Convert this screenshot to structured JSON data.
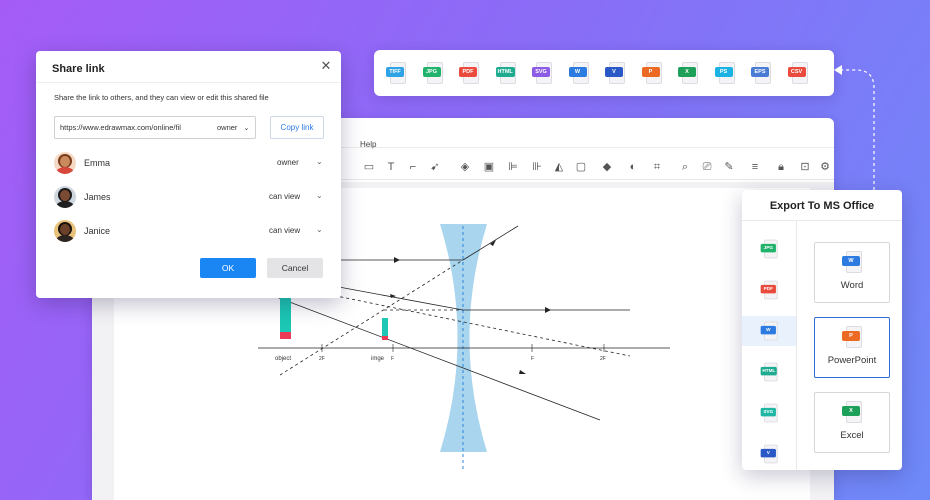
{
  "editor": {
    "menu_help": "Help",
    "diagram_labels": {
      "object": "object",
      "image": "imge",
      "f_left_small": "F",
      "two_f_left": "2F",
      "f_right": "F",
      "two_f_right": "2F"
    }
  },
  "export_strip": {
    "formats": [
      {
        "label": "TIFF",
        "color": "#2fa3e6"
      },
      {
        "label": "JPG",
        "color": "#21b36d"
      },
      {
        "label": "PDF",
        "color": "#ea4b3c"
      },
      {
        "label": "HTML",
        "color": "#1eab8f"
      },
      {
        "label": "SVG",
        "color": "#8c5ce6"
      },
      {
        "label": "W",
        "color": "#2d7be0"
      },
      {
        "label": "V",
        "color": "#2a59c7"
      },
      {
        "label": "P",
        "color": "#ec6a23"
      },
      {
        "label": "X",
        "color": "#1da15a"
      },
      {
        "label": "PS",
        "color": "#1ab3e3"
      },
      {
        "label": "EPS",
        "color": "#4a7cd6"
      },
      {
        "label": "CSV",
        "color": "#ea4b3c"
      }
    ]
  },
  "share": {
    "title": "Share link",
    "description": "Share the link to others, and they can view or edit this shared file",
    "link_url": "https://www.edrawmax.com/online/fil",
    "link_permission": "owner",
    "copy_label": "Copy link",
    "people": [
      {
        "name": "Emma",
        "permission": "owner",
        "skin": "#c98a5e",
        "hair": "#7a3b1a",
        "shirt": "#d8473c",
        "bg": "#f6d9c5"
      },
      {
        "name": "James",
        "permission": "can view",
        "skin": "#7a4a32",
        "hair": "#1a1a1a",
        "shirt": "#1f1f1f",
        "bg": "#cfd6dd"
      },
      {
        "name": "Janice",
        "permission": "can view",
        "skin": "#6b4028",
        "hair": "#1c120c",
        "shirt": "#2b2320",
        "bg": "#e8c17a"
      }
    ],
    "ok_label": "OK",
    "cancel_label": "Cancel"
  },
  "ms_office": {
    "title": "Export To MS Office",
    "left_formats": [
      {
        "label": "JPG",
        "color": "#21b36d"
      },
      {
        "label": "PDF",
        "color": "#ea4b3c"
      },
      {
        "label": "W",
        "color": "#2d7be0"
      },
      {
        "label": "HTML",
        "color": "#1eab8f"
      },
      {
        "label": "SVG",
        "color": "#1fb7a4"
      },
      {
        "label": "V",
        "color": "#2a59c7"
      }
    ],
    "selected_left_index": 2,
    "cards": [
      {
        "label": "Word",
        "tag": "W",
        "color": "#2d7be0"
      },
      {
        "label": "PowerPoint",
        "tag": "P",
        "color": "#ec6a23"
      },
      {
        "label": "Excel",
        "tag": "X",
        "color": "#1da15a"
      }
    ],
    "selected_card": "PowerPoint"
  }
}
